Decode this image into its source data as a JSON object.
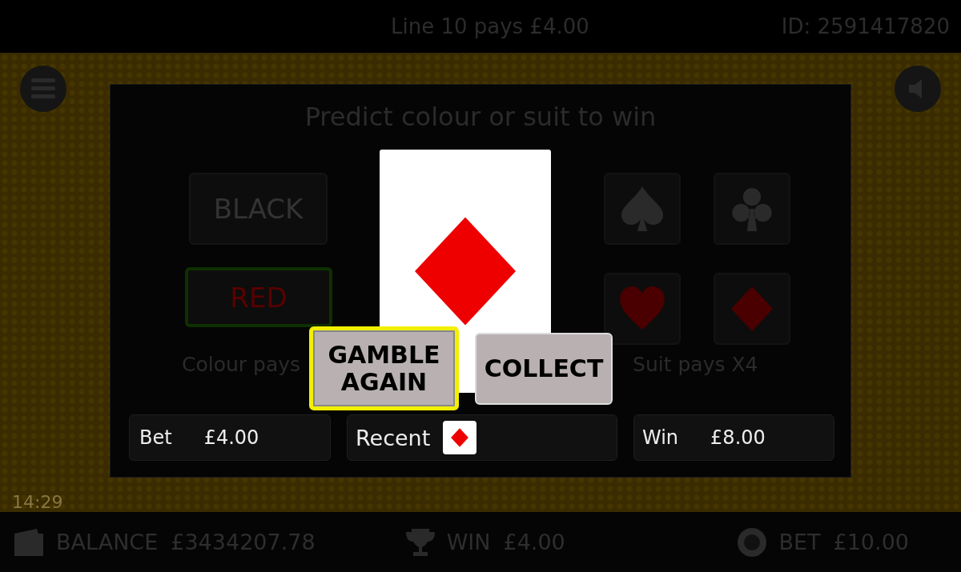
{
  "top_bar": {
    "line_win": "Line 10 pays £4.00",
    "id": "ID: 2591417820"
  },
  "gamble": {
    "title": "Predict colour or suit to win",
    "colours": [
      {
        "label": "BLACK",
        "selected": false
      },
      {
        "label": "RED",
        "selected": true
      }
    ],
    "suits": [
      {
        "kind": "spade",
        "selected": false
      },
      {
        "kind": "club",
        "selected": false
      },
      {
        "kind": "heart",
        "selected": false
      },
      {
        "kind": "diamond",
        "selected": false
      }
    ],
    "colour_pays": "Colour pays",
    "suit_pays": "Suit pays X4",
    "card": {
      "kind": "diamond"
    },
    "buttons": [
      {
        "label": "GAMBLE AGAIN",
        "selected": true
      },
      {
        "label": "COLLECT",
        "selected": false
      }
    ],
    "bet": {
      "label": "Bet",
      "value": "£4.00"
    },
    "recent": {
      "label": "Recent",
      "cards": [
        {
          "kind": "diamond"
        }
      ]
    },
    "win": {
      "label": "Win",
      "value": "£8.00"
    }
  },
  "clock": "14:29",
  "status_bar": [
    {
      "kind": "wallet",
      "label": "BALANCE",
      "value": "£3434207.78"
    },
    {
      "kind": "trophy",
      "label": "WIN",
      "value": "£4.00"
    },
    {
      "kind": "chip",
      "label": "BET",
      "value": "£10.00"
    }
  ]
}
